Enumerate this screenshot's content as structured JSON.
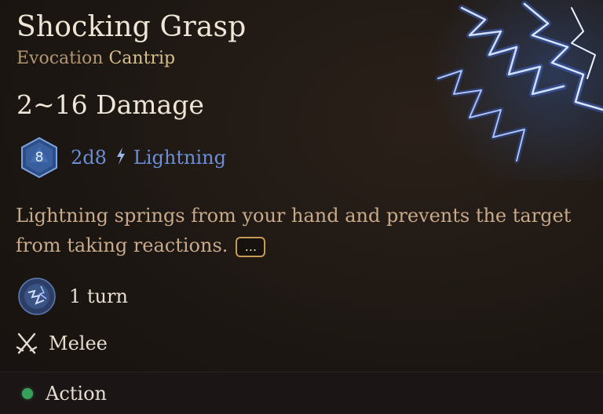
{
  "spell": {
    "title": "Shocking Grasp",
    "school": "Evocation",
    "level": "Cantrip",
    "damage_range": "2~16 Damage",
    "dice": {
      "face_number": "8",
      "roll": "2d8",
      "damage_type": "Lightning"
    },
    "description": "Lightning springs from your hand and prevents the target from taking reactions.",
    "more_label": "...",
    "duration": "1 turn",
    "range": "Melee",
    "cost": "Action"
  },
  "colors": {
    "title": "#efe6d8",
    "school": "#b49673",
    "level": "#d8c08a",
    "damage_type": "#6b8fd6",
    "description": "#c8a98a",
    "action_dot": "#37a05a",
    "more_border": "#c79a55"
  },
  "icons": {
    "spell_art": "lightning-art",
    "dice": "d8-dice-icon",
    "damage_type": "lightning-bolt-icon",
    "duration": "turn-icon",
    "range": "melee-swords-icon",
    "cost": "action-dot-icon"
  }
}
